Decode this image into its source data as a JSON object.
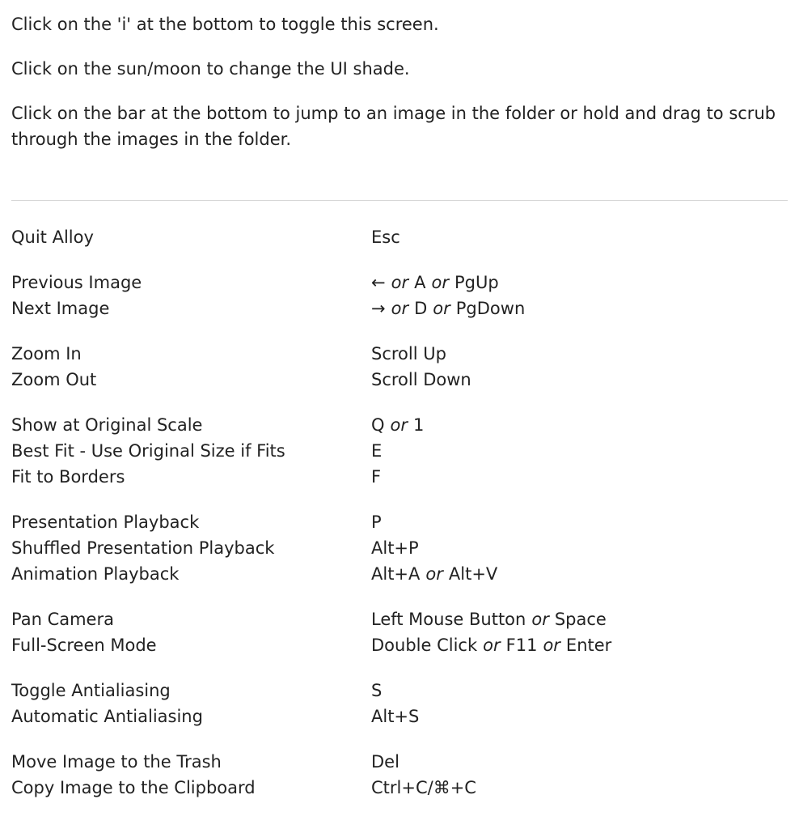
{
  "intro": [
    "Click on the 'i' at the bottom to toggle this screen.",
    "Click on the sun/moon to change the UI shade.",
    "Click on the bar at the bottom to jump to an image in the folder or hold and drag to scrub through the images in the folder."
  ],
  "or_word": "or",
  "groups": [
    [
      {
        "action": "Quit Alloy",
        "keys": [
          "Esc"
        ]
      }
    ],
    [
      {
        "action": "Previous Image",
        "keys": [
          "←",
          "A",
          "PgUp"
        ]
      },
      {
        "action": "Next Image",
        "keys": [
          "→",
          "D",
          "PgDown"
        ]
      }
    ],
    [
      {
        "action": "Zoom In",
        "keys": [
          "Scroll Up"
        ]
      },
      {
        "action": "Zoom Out",
        "keys": [
          "Scroll Down"
        ]
      }
    ],
    [
      {
        "action": "Show at Original Scale",
        "keys": [
          "Q",
          "1"
        ]
      },
      {
        "action": "Best Fit - Use Original Size if Fits",
        "keys": [
          "E"
        ]
      },
      {
        "action": "Fit to Borders",
        "keys": [
          "F"
        ]
      }
    ],
    [
      {
        "action": "Presentation Playback",
        "keys": [
          "P"
        ]
      },
      {
        "action": "Shuffled Presentation Playback",
        "keys": [
          "Alt+P"
        ]
      },
      {
        "action": "Animation Playback",
        "keys": [
          "Alt+A",
          "Alt+V"
        ]
      }
    ],
    [
      {
        "action": "Pan Camera",
        "keys": [
          "Left Mouse Button",
          "Space"
        ]
      },
      {
        "action": "Full-Screen Mode",
        "keys": [
          "Double Click",
          "F11",
          "Enter"
        ]
      }
    ],
    [
      {
        "action": "Toggle Antialiasing",
        "keys": [
          "S"
        ]
      },
      {
        "action": "Automatic Antialiasing",
        "keys": [
          "Alt+S"
        ]
      }
    ],
    [
      {
        "action": "Move Image to the Trash",
        "keys": [
          "Del"
        ]
      },
      {
        "action": "Copy Image to the Clipboard",
        "keys": [
          "Ctrl+C/⌘+C"
        ]
      }
    ]
  ]
}
